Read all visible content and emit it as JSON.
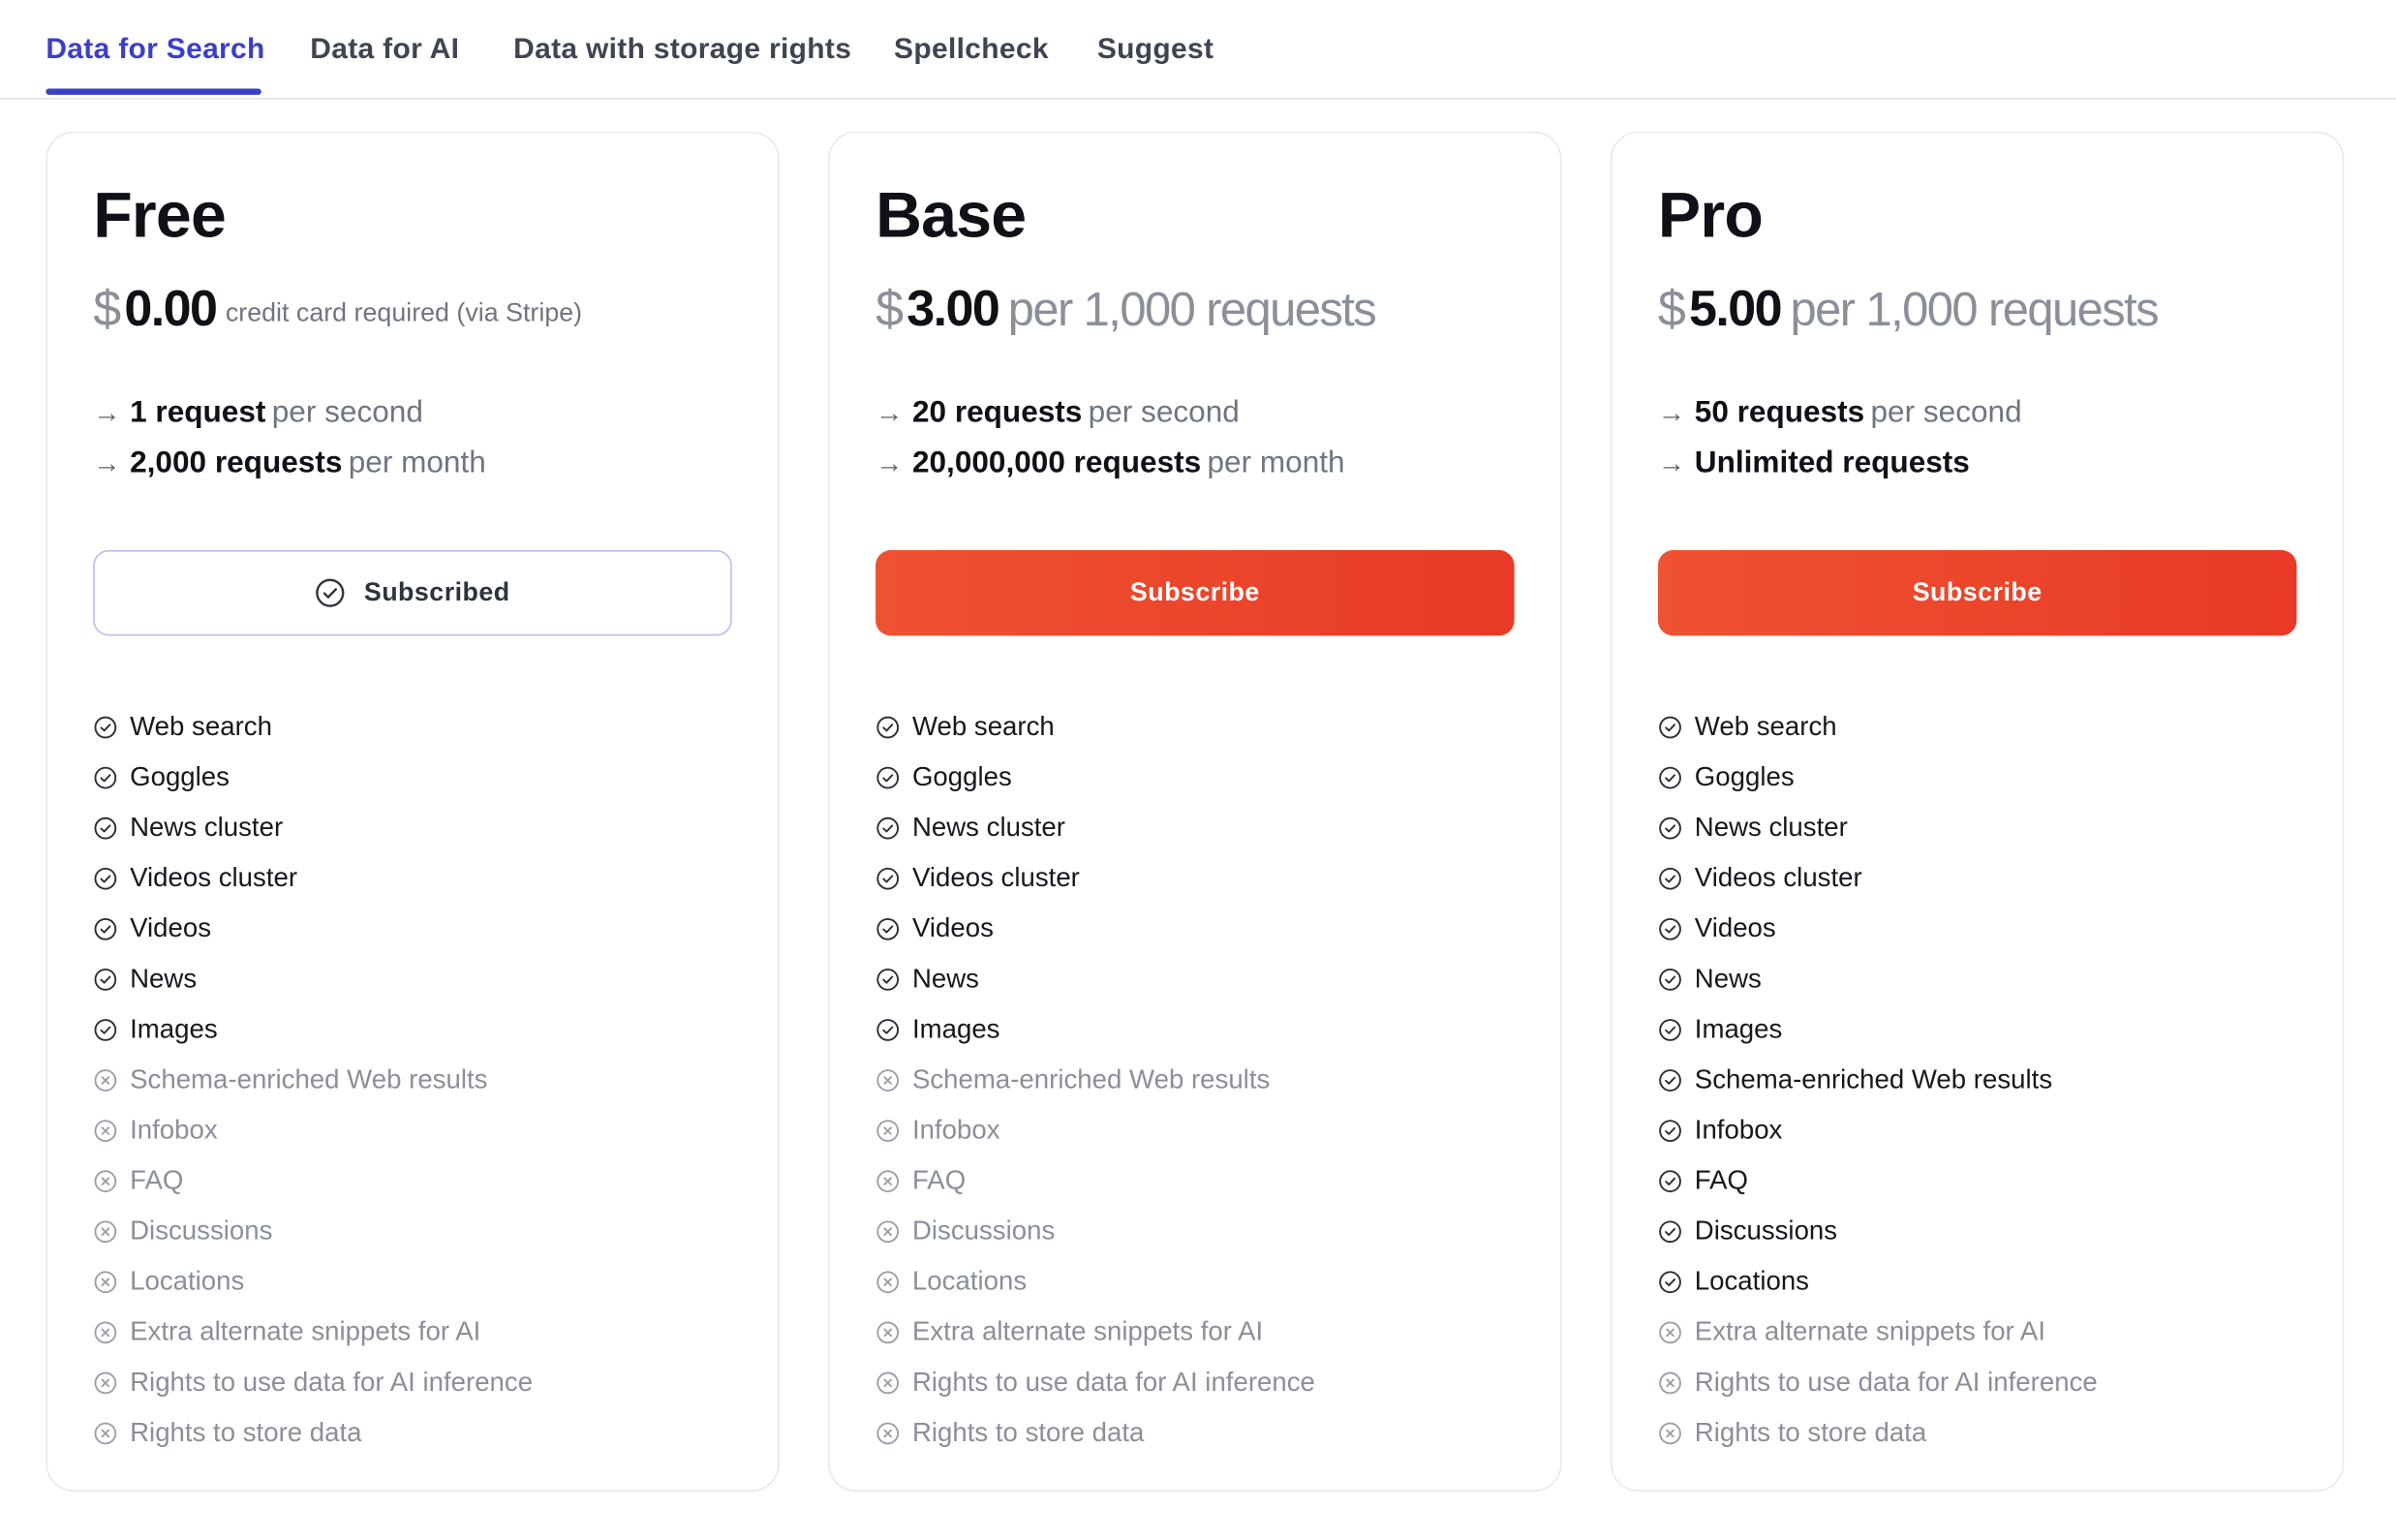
{
  "tabs": [
    {
      "label": "Data for Search",
      "active": true
    },
    {
      "label": "Data for AI",
      "active": false
    },
    {
      "label": "Data with storage rights",
      "active": false
    },
    {
      "label": "Spellcheck",
      "active": false
    },
    {
      "label": "Suggest",
      "active": false
    }
  ],
  "colors": {
    "accent": "#3b3fc6",
    "subscribe_button": "#ec4529",
    "included": "#15181d",
    "excluded": "#8a8f98"
  },
  "icons": {
    "limit": "arrow-right-icon",
    "included": "check-circle-icon",
    "excluded": "x-circle-icon"
  },
  "plans": [
    {
      "name": "Free",
      "currency": "$",
      "amount": "0.00",
      "price_note": "credit card required (via Stripe)",
      "limits": [
        {
          "strong": "1 request",
          "muted": "per second"
        },
        {
          "strong": "2,000 requests",
          "muted": "per month"
        }
      ],
      "button": {
        "label": "Subscribed",
        "state": "subscribed"
      },
      "features": [
        {
          "label": "Web search",
          "included": true
        },
        {
          "label": "Goggles",
          "included": true
        },
        {
          "label": "News cluster",
          "included": true
        },
        {
          "label": "Videos cluster",
          "included": true
        },
        {
          "label": "Videos",
          "included": true
        },
        {
          "label": "News",
          "included": true
        },
        {
          "label": "Images",
          "included": true
        },
        {
          "label": "Schema-enriched Web results",
          "included": false
        },
        {
          "label": "Infobox",
          "included": false
        },
        {
          "label": "FAQ",
          "included": false
        },
        {
          "label": "Discussions",
          "included": false
        },
        {
          "label": "Locations",
          "included": false
        },
        {
          "label": "Extra alternate snippets for AI",
          "included": false
        },
        {
          "label": "Rights to use data for AI inference",
          "included": false
        },
        {
          "label": "Rights to store data",
          "included": false
        }
      ]
    },
    {
      "name": "Base",
      "currency": "$",
      "amount": "3.00",
      "price_note": "per 1,000 requests",
      "limits": [
        {
          "strong": "20 requests",
          "muted": "per second"
        },
        {
          "strong": "20,000,000 requests",
          "muted": "per month"
        }
      ],
      "button": {
        "label": "Subscribe",
        "state": "subscribe"
      },
      "features": [
        {
          "label": "Web search",
          "included": true
        },
        {
          "label": "Goggles",
          "included": true
        },
        {
          "label": "News cluster",
          "included": true
        },
        {
          "label": "Videos cluster",
          "included": true
        },
        {
          "label": "Videos",
          "included": true
        },
        {
          "label": "News",
          "included": true
        },
        {
          "label": "Images",
          "included": true
        },
        {
          "label": "Schema-enriched Web results",
          "included": false
        },
        {
          "label": "Infobox",
          "included": false
        },
        {
          "label": "FAQ",
          "included": false
        },
        {
          "label": "Discussions",
          "included": false
        },
        {
          "label": "Locations",
          "included": false
        },
        {
          "label": "Extra alternate snippets for AI",
          "included": false
        },
        {
          "label": "Rights to use data for AI inference",
          "included": false
        },
        {
          "label": "Rights to store data",
          "included": false
        }
      ]
    },
    {
      "name": "Pro",
      "currency": "$",
      "amount": "5.00",
      "price_note": "per 1,000 requests",
      "limits": [
        {
          "strong": "50 requests",
          "muted": "per second"
        },
        {
          "strong": "Unlimited requests",
          "muted": ""
        }
      ],
      "button": {
        "label": "Subscribe",
        "state": "subscribe"
      },
      "features": [
        {
          "label": "Web search",
          "included": true
        },
        {
          "label": "Goggles",
          "included": true
        },
        {
          "label": "News cluster",
          "included": true
        },
        {
          "label": "Videos cluster",
          "included": true
        },
        {
          "label": "Videos",
          "included": true
        },
        {
          "label": "News",
          "included": true
        },
        {
          "label": "Images",
          "included": true
        },
        {
          "label": "Schema-enriched Web results",
          "included": true
        },
        {
          "label": "Infobox",
          "included": true
        },
        {
          "label": "FAQ",
          "included": true
        },
        {
          "label": "Discussions",
          "included": true
        },
        {
          "label": "Locations",
          "included": true
        },
        {
          "label": "Extra alternate snippets for AI",
          "included": false
        },
        {
          "label": "Rights to use data for AI inference",
          "included": false
        },
        {
          "label": "Rights to store data",
          "included": false
        }
      ]
    }
  ]
}
